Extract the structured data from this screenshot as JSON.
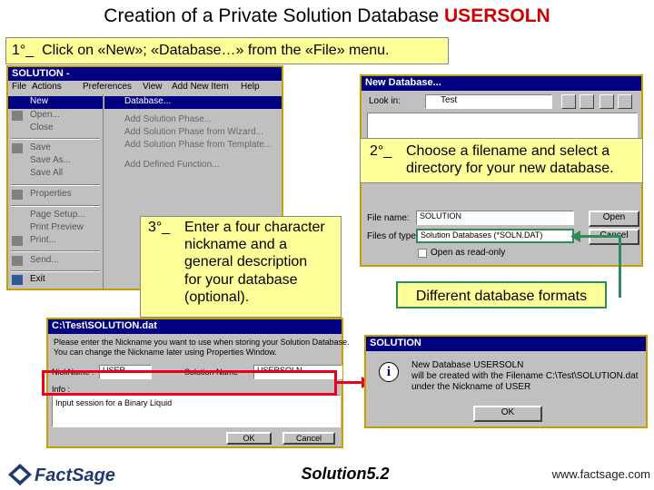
{
  "header": {
    "title_prefix": "Creation of a Private Solution Database ",
    "title_emphasis": "USERSOLN"
  },
  "steps": {
    "step1": {
      "number": "1°_",
      "text": "Click on «New»; «Database…» from the «File» menu."
    },
    "step2": {
      "number": "2°_",
      "line1": "Choose a filename and select a",
      "line2": "directory for your new database."
    },
    "step3": {
      "number": "3°_",
      "line1": "Enter a four character",
      "line2": "nickname and a",
      "line3": "general description",
      "line4": "for your database",
      "line5": "(optional)."
    },
    "formats_note": "Different database formats"
  },
  "menu_window": {
    "title": "SOLUTION -",
    "menubar": [
      "File",
      "Actions",
      "Preferences",
      "View",
      "Add New Item",
      "Help"
    ],
    "file_menu": [
      "New",
      "Open...",
      "Close",
      "Save",
      "Save As...",
      "Save All",
      "Properties",
      "Page Setup...",
      "Print Preview",
      "Print...",
      "Send...",
      "Exit"
    ],
    "new_submenu": [
      "Database...",
      "Add Solution Phase...",
      "Add Solution Phase from Wizard...",
      "Add Solution Phase from Template...",
      "Add Defined Function..."
    ]
  },
  "newdb_dialog": {
    "title": "New Database...",
    "look_in_label": "Look in:",
    "look_in_value": "Test",
    "file_name_label": "File name:",
    "file_name_value": "SOLUTION",
    "files_of_type_label": "Files of type:",
    "files_of_type_value": "Solution Databases (*SOLN.DAT)",
    "open_button": "Open",
    "cancel_button": "Cancel",
    "read_only_label": "Open as read-only"
  },
  "soldat_dialog": {
    "title": "C:\\Test\\SOLUTION.dat",
    "prompt_line1": "Please enter the Nickname you want to use when storing your Solution Database.",
    "prompt_line2": "You can change the Nickname later using Properties Window.",
    "nickname_label": "NickName :",
    "nickname_value": "USER",
    "solution_name_label": "Solution Name",
    "solution_name_value": "USERSOLN",
    "info_label": "Info :",
    "info_value": "Input session for a Binary Liquid",
    "ok_button": "OK",
    "cancel_button": "Cancel"
  },
  "message_box": {
    "title": "SOLUTION",
    "line1": "New Database USERSOLN",
    "line2": "will be created with the Filename C:\\Test\\SOLUTION.dat",
    "line3": "under the Nickname of USER",
    "ok_button": "OK",
    "icon": "info-icon"
  },
  "footer": {
    "logo_text": "FactSage",
    "center_title": "Solution5.2",
    "url": "www.factsage.com"
  },
  "colors": {
    "callout_bg": "#ffff99",
    "title_accent": "#cc0000",
    "highlight_red": "#e8001c",
    "connector_green": "#2e8b57",
    "window_border": "#c5a000"
  }
}
